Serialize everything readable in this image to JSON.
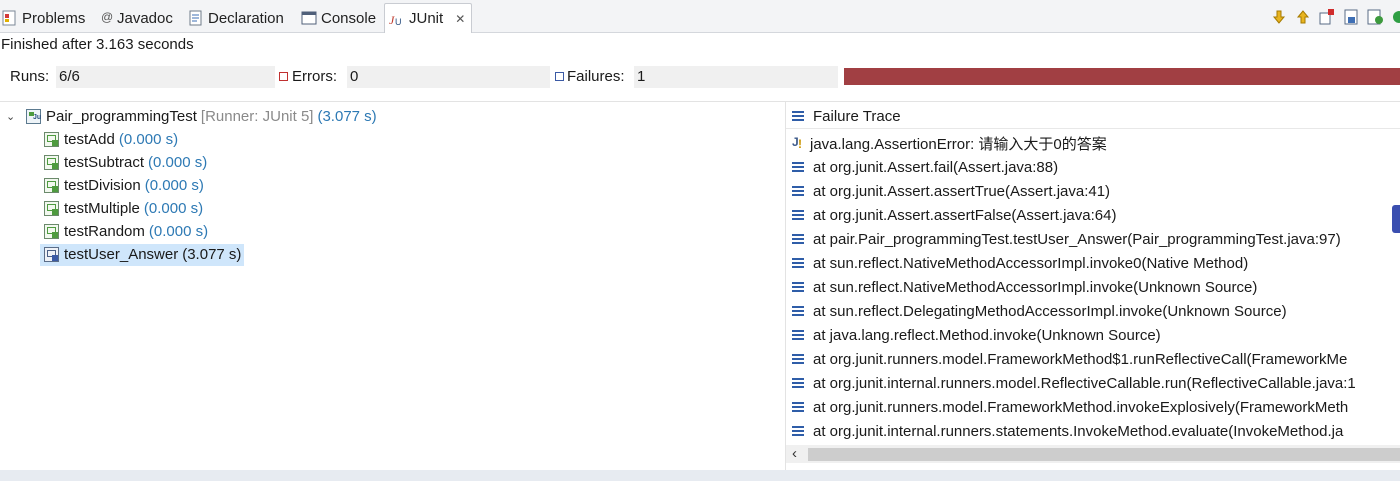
{
  "tabs": [
    {
      "label": "Problems",
      "icon": "problems-icon"
    },
    {
      "label": "Javadoc",
      "icon": "javadoc-icon"
    },
    {
      "label": "Declaration",
      "icon": "declaration-icon"
    },
    {
      "label": "Console",
      "icon": "console-icon"
    },
    {
      "label": "JUnit",
      "icon": "junit-icon",
      "active": true
    }
  ],
  "toolbar": [
    "next-failure-icon",
    "previous-failure-icon",
    "show-failures-only-icon",
    "scroll-lock-icon",
    "rerun-test-icon",
    "run-icon"
  ],
  "status": "Finished after 3.163 seconds",
  "counters": {
    "runs_label": "Runs:",
    "runs_value": "6/6",
    "errors_label": "Errors:",
    "errors_value": "0",
    "failures_label": "Failures:",
    "failures_value": "1"
  },
  "progress": {
    "fraction": 1.0,
    "color": "#a13f43"
  },
  "tree": {
    "suite": {
      "name": "Pair_programmingTest",
      "runner": "[Runner: JUnit 5]",
      "time": "(3.077 s)"
    },
    "tests": [
      {
        "name": "testAdd",
        "time": "(0.000 s)",
        "status": "passed"
      },
      {
        "name": "testSubtract",
        "time": "(0.000 s)",
        "status": "passed"
      },
      {
        "name": "testDivision",
        "time": "(0.000 s)",
        "status": "passed"
      },
      {
        "name": "testMultiple",
        "time": "(0.000 s)",
        "status": "passed"
      },
      {
        "name": "testRandom",
        "time": "(0.000 s)",
        "status": "passed"
      },
      {
        "name": "testUser_Answer",
        "time": "(3.077 s)",
        "status": "failed",
        "selected": true
      }
    ]
  },
  "trace": {
    "title": "Failure Trace",
    "exception": "java.lang.AssertionError: 请输入大于0的答案",
    "lines": [
      "at org.junit.Assert.fail(Assert.java:88)",
      "at org.junit.Assert.assertTrue(Assert.java:41)",
      "at org.junit.Assert.assertFalse(Assert.java:64)",
      "at pair.Pair_programmingTest.testUser_Answer(Pair_programmingTest.java:97)",
      "at sun.reflect.NativeMethodAccessorImpl.invoke0(Native Method)",
      "at sun.reflect.NativeMethodAccessorImpl.invoke(Unknown Source)",
      "at sun.reflect.DelegatingMethodAccessorImpl.invoke(Unknown Source)",
      "at java.lang.reflect.Method.invoke(Unknown Source)",
      "at org.junit.runners.model.FrameworkMethod$1.runReflectiveCall(FrameworkMe",
      "at org.junit.internal.runners.model.ReflectiveCallable.run(ReflectiveCallable.java:1",
      "at org.junit.runners.model.FrameworkMethod.invokeExplosively(FrameworkMeth",
      "at org.junit.internal.runners.statements.InvokeMethod.evaluate(InvokeMethod.ja"
    ],
    "scroll_left": "‹"
  }
}
